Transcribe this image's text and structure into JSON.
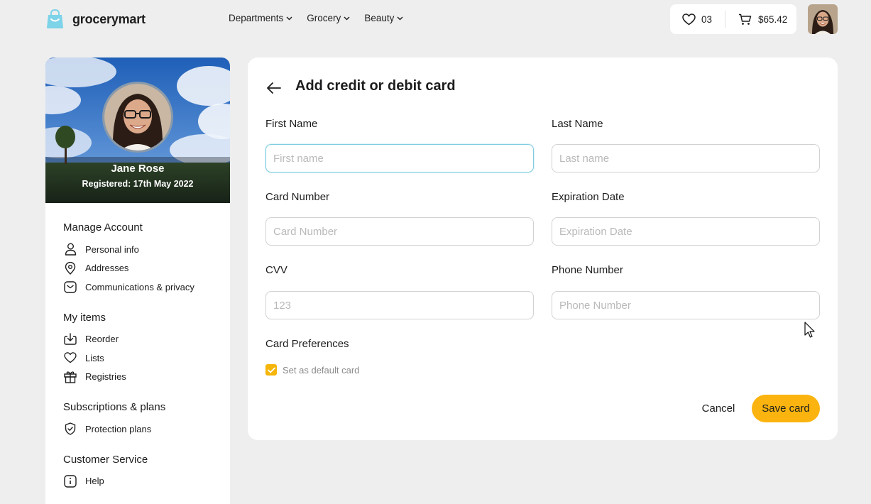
{
  "header": {
    "brand": "grocerymart",
    "nav": [
      {
        "label": "Departments"
      },
      {
        "label": "Grocery"
      },
      {
        "label": "Beauty"
      }
    ],
    "favorites_count": "03",
    "cart_total": "$65.42"
  },
  "profile": {
    "name": "Jane Rose",
    "registered": "Registered: 17th May 2022"
  },
  "sidebar": {
    "groups": [
      {
        "title": "Manage Account",
        "items": [
          {
            "label": "Personal info",
            "icon": "user-icon"
          },
          {
            "label": "Addresses",
            "icon": "location-pin-icon"
          },
          {
            "label": "Communications & privacy",
            "icon": "message-icon"
          }
        ]
      },
      {
        "title": "My items",
        "items": [
          {
            "label": "Reorder",
            "icon": "download-icon"
          },
          {
            "label": "Lists",
            "icon": "heart-icon"
          },
          {
            "label": "Registries",
            "icon": "gift-icon"
          }
        ]
      },
      {
        "title": "Subscriptions & plans",
        "items": [
          {
            "label": "Protection plans",
            "icon": "shield-icon"
          }
        ]
      },
      {
        "title": "Customer Service",
        "items": [
          {
            "label": "Help",
            "icon": "info-icon"
          }
        ]
      }
    ]
  },
  "form": {
    "title": "Add credit or debit card",
    "first_name": {
      "label": "First Name",
      "placeholder": "First name",
      "value": ""
    },
    "last_name": {
      "label": "Last Name",
      "placeholder": "Last name",
      "value": ""
    },
    "card_number": {
      "label": "Card Number",
      "placeholder": "Card Number",
      "value": ""
    },
    "expiration": {
      "label": "Expiration Date",
      "placeholder": "Expiration Date",
      "value": ""
    },
    "cvv": {
      "label": "CVV",
      "placeholder": "123",
      "value": ""
    },
    "phone": {
      "label": "Phone Number",
      "placeholder": "Phone Number",
      "value": ""
    },
    "preferences_title": "Card Preferences",
    "default_card_label": "Set as default card",
    "default_card_checked": true,
    "cancel_label": "Cancel",
    "save_label": "Save card"
  },
  "colors": {
    "accent": "#fbb40f",
    "logo": "#7dd3e8",
    "focus_border": "#80cce0",
    "page_bg": "#eeeeee"
  }
}
